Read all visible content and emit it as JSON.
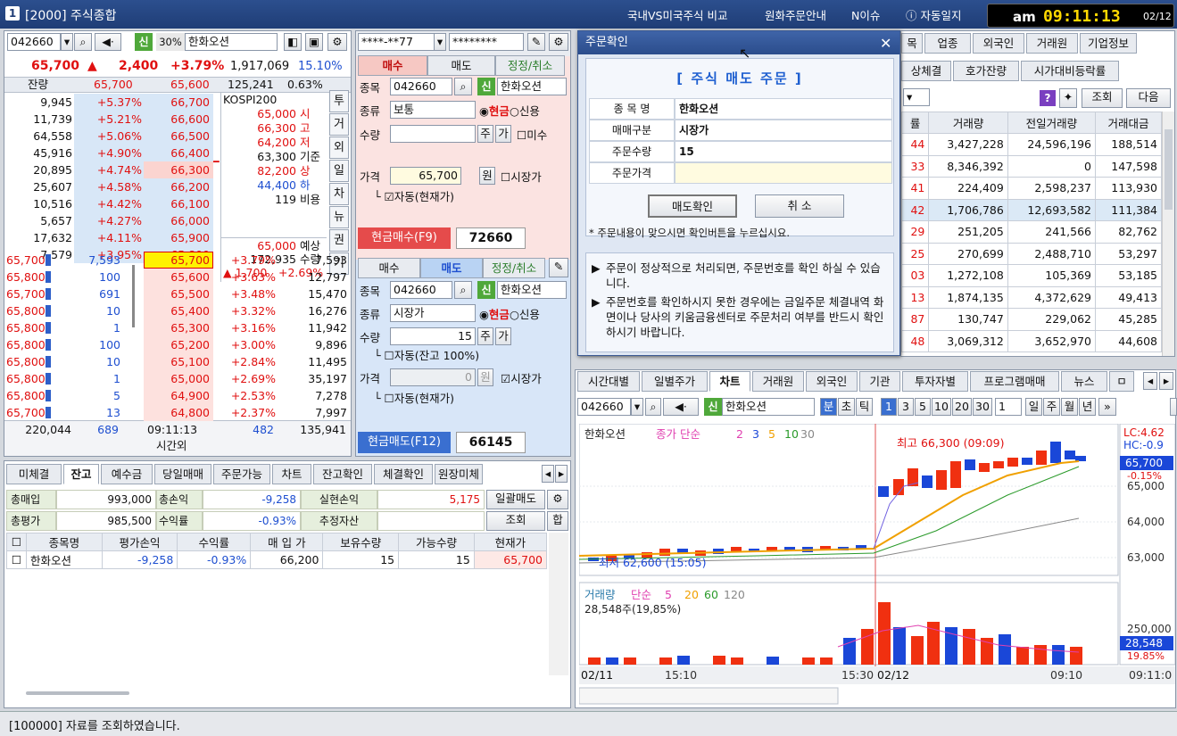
{
  "window": {
    "number": "1",
    "title": "[2000] 주식종합"
  },
  "topmenu": [
    "국내VS미국주식 비교",
    "원화주문안내",
    "N이슈",
    "자동일지"
  ],
  "clock": {
    "ampm": "am",
    "time": "09:11:13",
    "date": "02/12"
  },
  "quote": {
    "code": "042660",
    "name": "한화오션",
    "pct_label": "30%",
    "last": "65,700",
    "arrow": "▲",
    "change": "2,400",
    "rate": "+3.79%",
    "volume": "1,917,069",
    "turnover": "15.10%",
    "remain_label": "잔량",
    "ask1": "65,700",
    "bid1": "65,600",
    "vol2": "125,241",
    "ratio2": "0.63%"
  },
  "orderbook_asks": [
    {
      "qty": "9,945",
      "rate": "+5.37%",
      "price": "66,700"
    },
    {
      "qty": "11,739",
      "rate": "+5.21%",
      "price": "66,600"
    },
    {
      "qty": "64,558",
      "rate": "+5.06%",
      "price": "66,500"
    },
    {
      "qty": "45,916",
      "rate": "+4.90%",
      "price": "66,400"
    },
    {
      "qty": "20,895",
      "rate": "+4.74%",
      "price": "66,300"
    },
    {
      "qty": "25,607",
      "rate": "+4.58%",
      "price": "66,200"
    },
    {
      "qty": "10,516",
      "rate": "+4.42%",
      "price": "66,100"
    },
    {
      "qty": "5,657",
      "rate": "+4.27%",
      "price": "66,000"
    },
    {
      "qty": "17,632",
      "rate": "+4.11%",
      "price": "65,900"
    },
    {
      "qty": "7,579",
      "rate": "+3.95%",
      "price": "65,800"
    }
  ],
  "info": {
    "index_name": "KOSPI200",
    "open": "65,000",
    "open_l": "시",
    "high": "66,300",
    "high_l": "고",
    "low": "64,200",
    "low_l": "저",
    "base": "63,300",
    "base_l": "기준",
    "upper": "82,200",
    "upper_l": "상",
    "lower": "44,400",
    "lower_l": "하",
    "ratio": "119",
    "ratio_l": "비용",
    "exp": "65,000",
    "exp_l": "예상",
    "expq": "172,935",
    "expq_l": "수량",
    "diff": "1,700",
    "diffr": "+2.69%"
  },
  "side_tabs": [
    "투",
    "거",
    "외",
    "일",
    "차",
    "뉴",
    "권",
    "기"
  ],
  "orderbook_bids": [
    {
      "fill": "65,700",
      "fq": "7,593",
      "price": "65,700",
      "rate": "+3.79%",
      "qty": "7,593"
    },
    {
      "fill": "65,800",
      "fq": "100",
      "price": "65,600",
      "rate": "+3.63%",
      "qty": "12,797"
    },
    {
      "fill": "65,700",
      "fq": "691",
      "price": "65,500",
      "rate": "+3.48%",
      "qty": "15,470"
    },
    {
      "fill": "65,800",
      "fq": "10",
      "price": "65,400",
      "rate": "+3.32%",
      "qty": "16,276"
    },
    {
      "fill": "65,800",
      "fq": "1",
      "price": "65,300",
      "rate": "+3.16%",
      "qty": "11,942"
    },
    {
      "fill": "65,800",
      "fq": "100",
      "price": "65,200",
      "rate": "+3.00%",
      "qty": "9,896"
    },
    {
      "fill": "65,800",
      "fq": "10",
      "price": "65,100",
      "rate": "+2.84%",
      "qty": "11,495"
    },
    {
      "fill": "65,800",
      "fq": "1",
      "price": "65,000",
      "rate": "+2.69%",
      "qty": "35,197"
    },
    {
      "fill": "65,800",
      "fq": "5",
      "price": "64,900",
      "rate": "+2.53%",
      "qty": "7,278"
    },
    {
      "fill": "65,700",
      "fq": "13",
      "price": "64,800",
      "rate": "+2.37%",
      "qty": "7,997"
    }
  ],
  "ob_total": {
    "ask": "220,044",
    "mid": "689",
    "time": "09:11:13",
    "bid": "482",
    "sum": "135,941",
    "after": "시간외"
  },
  "order": {
    "account": "****-**77",
    "password": "********",
    "tabs": [
      "매수",
      "매도",
      "정정/취소"
    ],
    "code": "042660",
    "name": "한화오션",
    "kind_l": "종목",
    "type_l": "종류",
    "type": "보통",
    "cash": "현금",
    "credit": "신용",
    "qty_l": "수량",
    "price_l": "가격",
    "price": "65,700",
    "won": "원",
    "market": "시장가",
    "auto": "자동(현재가)",
    "missu": "미수",
    "ju": "주",
    "ga": "가",
    "buy_btn": "현금매수(F9)",
    "buy_code": "72660",
    "sell_type": "시장가",
    "sell_qty": "15",
    "sell_price": "0",
    "sell_auto1": "자동(잔고 100%)",
    "sell_auto2": "자동(현재가)",
    "sell_btn": "현금매도(F12)",
    "sell_code": "66145"
  },
  "dialog": {
    "title": "주문확인",
    "heading": "[ 주식 매도 주문 ]",
    "rows": [
      {
        "k": "종 목 명",
        "v": "한화오션"
      },
      {
        "k": "매매구분",
        "v": "시장가"
      },
      {
        "k": "주문수량",
        "v": "15"
      },
      {
        "k": "주문가격",
        "v": ""
      }
    ],
    "ok": "매도확인",
    "cancel": "취 소",
    "hint": "* 주문내용이 맞으시면 확인버튼을 누르십시요.",
    "note1": "주문이 정상적으로 처리되면, 주문번호를 확인 하실 수 있습니다.",
    "note2": "주문번호를 확인하시지 못한 경우에는 금일주문 체결내역 화면이나 당사의 키움금융센터로 주문처리 여부를 반드시 확인하시기 바랍니다."
  },
  "right_tabs_top": [
    "목",
    "업종",
    "외국인",
    "거래원",
    "기업정보"
  ],
  "right_tabs2": [
    "상체결",
    "호가잔량",
    "시가대비등락률"
  ],
  "right_btns": {
    "q": "조회",
    "next": "다음"
  },
  "right_table": {
    "headers": [
      "률",
      "거래량",
      "전일거래량",
      "거래대금"
    ],
    "rows": [
      [
        "44",
        "3,427,228",
        "24,596,196",
        "188,514"
      ],
      [
        "33",
        "8,346,392",
        "0",
        "147,598"
      ],
      [
        "41",
        "224,409",
        "2,598,237",
        "113,930"
      ],
      [
        "42",
        "1,706,786",
        "12,693,582",
        "111,384"
      ],
      [
        "29",
        "251,205",
        "241,566",
        "82,762"
      ],
      [
        "25",
        "270,699",
        "2,488,710",
        "53,297"
      ],
      [
        "03",
        "1,272,108",
        "105,369",
        "53,185"
      ],
      [
        "13",
        "1,874,135",
        "4,372,629",
        "49,413"
      ],
      [
        "87",
        "130,747",
        "229,062",
        "45,285"
      ],
      [
        "48",
        "3,069,312",
        "3,652,970",
        "44,608"
      ]
    ]
  },
  "chart_tabs": [
    "시간대별",
    "일별주가",
    "차트",
    "거래원",
    "외국인",
    "기관",
    "투자자별",
    "프로그램매매",
    "뉴스",
    "ㅁ"
  ],
  "chart_toolbar": {
    "code": "042660",
    "name": "한화오션",
    "periods": [
      "분",
      "초",
      "틱"
    ],
    "mins": [
      "1",
      "3",
      "5",
      "10",
      "20",
      "30"
    ],
    "sel": "1",
    "units": [
      "일",
      "주",
      "월",
      "년"
    ]
  },
  "chart_labels": {
    "legend_name": "한화오션",
    "legend_ma": "종가 단순",
    "ma": [
      "2",
      "3",
      "5",
      "10",
      "30"
    ],
    "high": "최고 66,300 (09:09)",
    "low": "최저 62,600 (15:05)",
    "lc": "LC:4.62",
    "hc": "HC:-0.9",
    "price_tag": "65,700",
    "pct_tag": "-0.15%",
    "y": [
      "65,000",
      "64,000",
      "63,000"
    ],
    "vol_legend": "거래량",
    "vol_ma": "단순",
    "vol_ma_vals": [
      "5",
      "20",
      "60",
      "120"
    ],
    "vol_now": "28,548주(19,85%)",
    "vol_y": "250,000",
    "vol_tag": "28,548",
    "vol_pct": "19.85%",
    "x": [
      "02/11",
      "15:10",
      "15:30",
      "02/12",
      "09:10",
      "09:11:0"
    ]
  },
  "bottom_tabs": [
    "미체결",
    "잔고",
    "예수금",
    "당일매매",
    "주문가능",
    "차트",
    "잔고확인",
    "체결확인",
    "원장미체"
  ],
  "balance": {
    "buy_l": "총매입",
    "buy": "993,000",
    "pl_l": "총손익",
    "pl": "-9,258",
    "real_l": "실현손익",
    "real": "5,175",
    "sell_all": "일괄매도",
    "eval_l": "총평가",
    "eval": "985,500",
    "ret_l": "수익률",
    "ret": "-0.93%",
    "est_l": "추정자산",
    "query": "조회",
    "sum": "합"
  },
  "holdings": {
    "headers": [
      "종목명",
      "평가손익",
      "수익률",
      "매 입 가",
      "보유수량",
      "가능수량",
      "현재가"
    ],
    "rows": [
      [
        "한화오션",
        "-9,258",
        "-0.93%",
        "66,200",
        "15",
        "15",
        "65,700"
      ]
    ]
  },
  "status": "[100000] 자료를 조회하였습니다."
}
